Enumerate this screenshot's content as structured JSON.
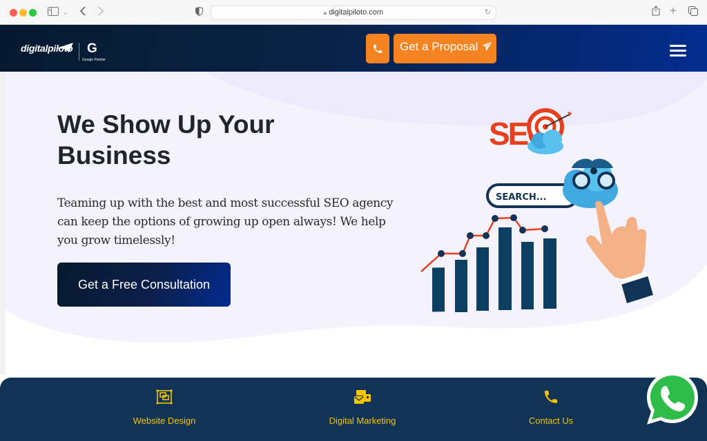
{
  "browser": {
    "url": "digitalpiloto.com"
  },
  "header": {
    "logo_text": "digitalpiloto",
    "partner_letter": "G",
    "partner_text": "Google Partner",
    "proposal_label": "Get a Proposal",
    "accent_color": "#f58322"
  },
  "hero": {
    "title": "We Show Up Your Business",
    "description": "Teaming up with the best and most successful SEO agency can keep the options of growing up open always! We help you grow timelessly!",
    "cta_label": "Get a Free Consultation",
    "illustration": {
      "seo_text": "SEO",
      "search_text": "SEARCH..."
    }
  },
  "bottom_nav": {
    "items": [
      {
        "label": "Website Design",
        "icon": "website-design-icon"
      },
      {
        "label": "Digital Marketing",
        "icon": "digital-marketing-icon"
      },
      {
        "label": "Contact Us",
        "icon": "phone-icon"
      }
    ],
    "item_color": "#f5c400"
  }
}
